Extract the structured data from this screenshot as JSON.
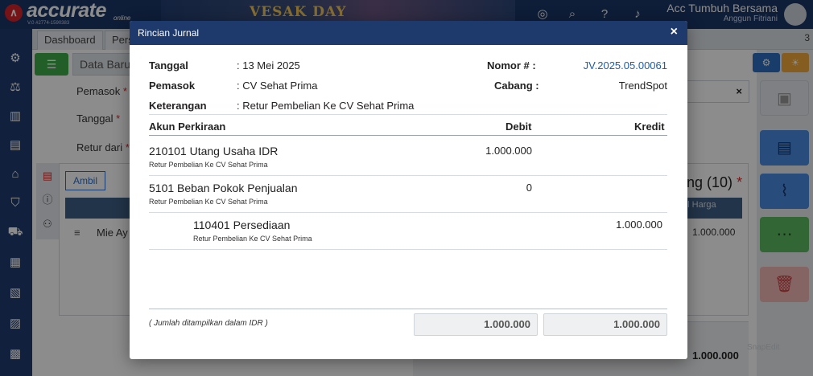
{
  "app": {
    "logo_text": "accurate",
    "logo_suffix": "online",
    "version": "V.0 #2774-1590383",
    "banner_text": "VESAK DAY",
    "company_name": "Acc Tumbuh Bersama",
    "user_name": "Anggun Fitriani"
  },
  "tabs": {
    "dashboard": "Dashboard",
    "second": "Pers",
    "count": "3"
  },
  "form": {
    "data_baru": "Data Baru",
    "pemasok_label": "Pemasok",
    "tanggal_label": "Tanggal",
    "retur_label": "Retur dari",
    "required_mark": "*",
    "ambil_label": "Ambil",
    "row_item": "Mie Ay",
    "row_menu": "≡",
    "side_title": "ng (10)",
    "total_header": "tal Harga",
    "row_total": "1.000.000",
    "bottom_total": "1.000.000",
    "x_clear": "×",
    "watermark": "SnapEdit"
  },
  "modal": {
    "title": "Rincian Jurnal",
    "close": "×",
    "tanggal_label": "Tanggal",
    "tanggal_value": ": 13 Mei 2025",
    "pemasok_label": "Pemasok",
    "pemasok_value": ": CV Sehat Prima",
    "keterangan_label": "Keterangan",
    "keterangan_value": ": Retur Pembelian Ke CV Sehat Prima",
    "nomor_label": "Nomor # :",
    "nomor_value": "JV.2025.05.00061",
    "cabang_label": "Cabang :",
    "cabang_value": "TrendSpot",
    "columns": {
      "akun": "Akun Perkiraan",
      "debit": "Debit",
      "kredit": "Kredit"
    },
    "rows": [
      {
        "code": "210101",
        "name": "Utang Usaha IDR",
        "desc": "Retur Pembelian Ke CV Sehat Prima",
        "debit": "1.000.000",
        "kredit": ""
      },
      {
        "code": "5101",
        "name": "Beban Pokok Penjualan",
        "desc": "Retur Pembelian Ke CV Sehat Prima",
        "debit": "0",
        "kredit": ""
      },
      {
        "code": "110401",
        "name": "Persediaan",
        "desc": "Retur Pembelian Ke CV Sehat Prima",
        "debit": "",
        "kredit": "1.000.000"
      }
    ],
    "footer_note": "( Jumlah ditampilkan dalam IDR )",
    "total_debit": "1.000.000",
    "total_kredit": "1.000.000"
  },
  "colors": {
    "header_navy": "#1e3a6d",
    "link_blue": "#1f5ca8",
    "accent_green": "#3fae49",
    "accent_red": "#d62e2e"
  }
}
